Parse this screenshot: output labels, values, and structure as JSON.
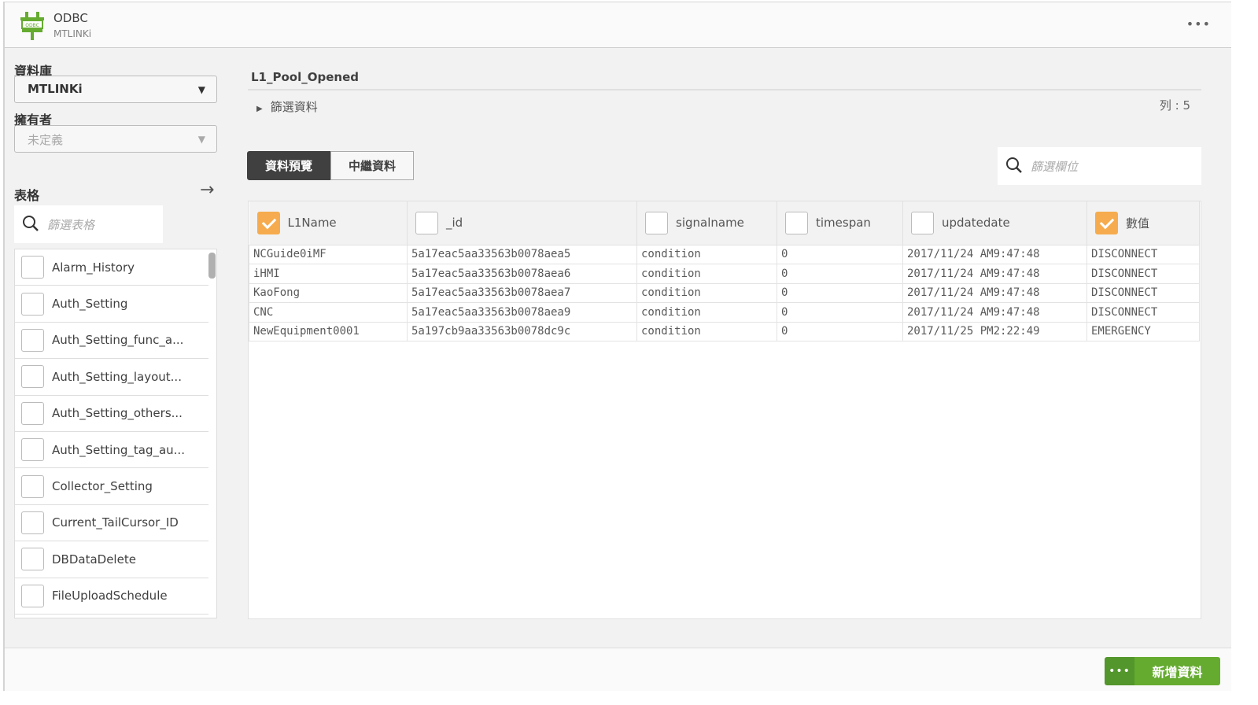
{
  "header": {
    "title": "ODBC",
    "subtitle": "MTLINKi",
    "logo_text": "ODBC",
    "more": "•••"
  },
  "sidebar": {
    "database_label": "資料庫",
    "database_value": "MTLINKi",
    "owner_label": "擁有者",
    "owner_value": "未定義",
    "tables_label": "表格",
    "search_placeholder": "篩選表格",
    "tables": [
      {
        "name": "Alarm_History",
        "checked": false
      },
      {
        "name": "Auth_Setting",
        "checked": false
      },
      {
        "name": "Auth_Setting_func_a...",
        "checked": false
      },
      {
        "name": "Auth_Setting_layout...",
        "checked": false
      },
      {
        "name": "Auth_Setting_others...",
        "checked": false
      },
      {
        "name": "Auth_Setting_tag_au...",
        "checked": false
      },
      {
        "name": "Collector_Setting",
        "checked": false
      },
      {
        "name": "Current_TailCursor_ID",
        "checked": false
      },
      {
        "name": "DBDataDelete",
        "checked": false
      },
      {
        "name": "FileUploadSchedule",
        "checked": false
      }
    ]
  },
  "main": {
    "table_title": "L1_Pool_Opened",
    "filter_label": "篩選資料",
    "row_count": "列 : 5",
    "tabs": [
      "資料預覽",
      "中繼資料"
    ],
    "field_search_placeholder": "篩選欄位",
    "columns": [
      {
        "name": "L1Name",
        "checked": true
      },
      {
        "name": "_id",
        "checked": false
      },
      {
        "name": "signalname",
        "checked": false
      },
      {
        "name": "timespan",
        "checked": false
      },
      {
        "name": "updatedate",
        "checked": false
      },
      {
        "name": "數值",
        "checked": true
      }
    ],
    "rows": [
      [
        "NCGuide0iMF",
        "5a17eac5aa33563b0078aea5",
        "condition",
        "0",
        "2017/11/24 AM9:47:48",
        "DISCONNECT"
      ],
      [
        "iHMI",
        "5a17eac5aa33563b0078aea6",
        "condition",
        "0",
        "2017/11/24 AM9:47:48",
        "DISCONNECT"
      ],
      [
        "KaoFong",
        "5a17eac5aa33563b0078aea7",
        "condition",
        "0",
        "2017/11/24 AM9:47:48",
        "DISCONNECT"
      ],
      [
        "CNC",
        "5a17eac5aa33563b0078aea9",
        "condition",
        "0",
        "2017/11/24 AM9:47:48",
        "DISCONNECT"
      ],
      [
        "NewEquipment0001",
        "5a197cb9aa33563b0078dc9c",
        "condition",
        "0",
        "2017/11/25 PM2:22:49",
        "EMERGENCY"
      ]
    ]
  },
  "footer": {
    "more": "•••",
    "add_label": "新增資料"
  },
  "colors": {
    "accent": "#65ab30",
    "checkbox": "#f6ac4e",
    "tab_active": "#404040"
  }
}
